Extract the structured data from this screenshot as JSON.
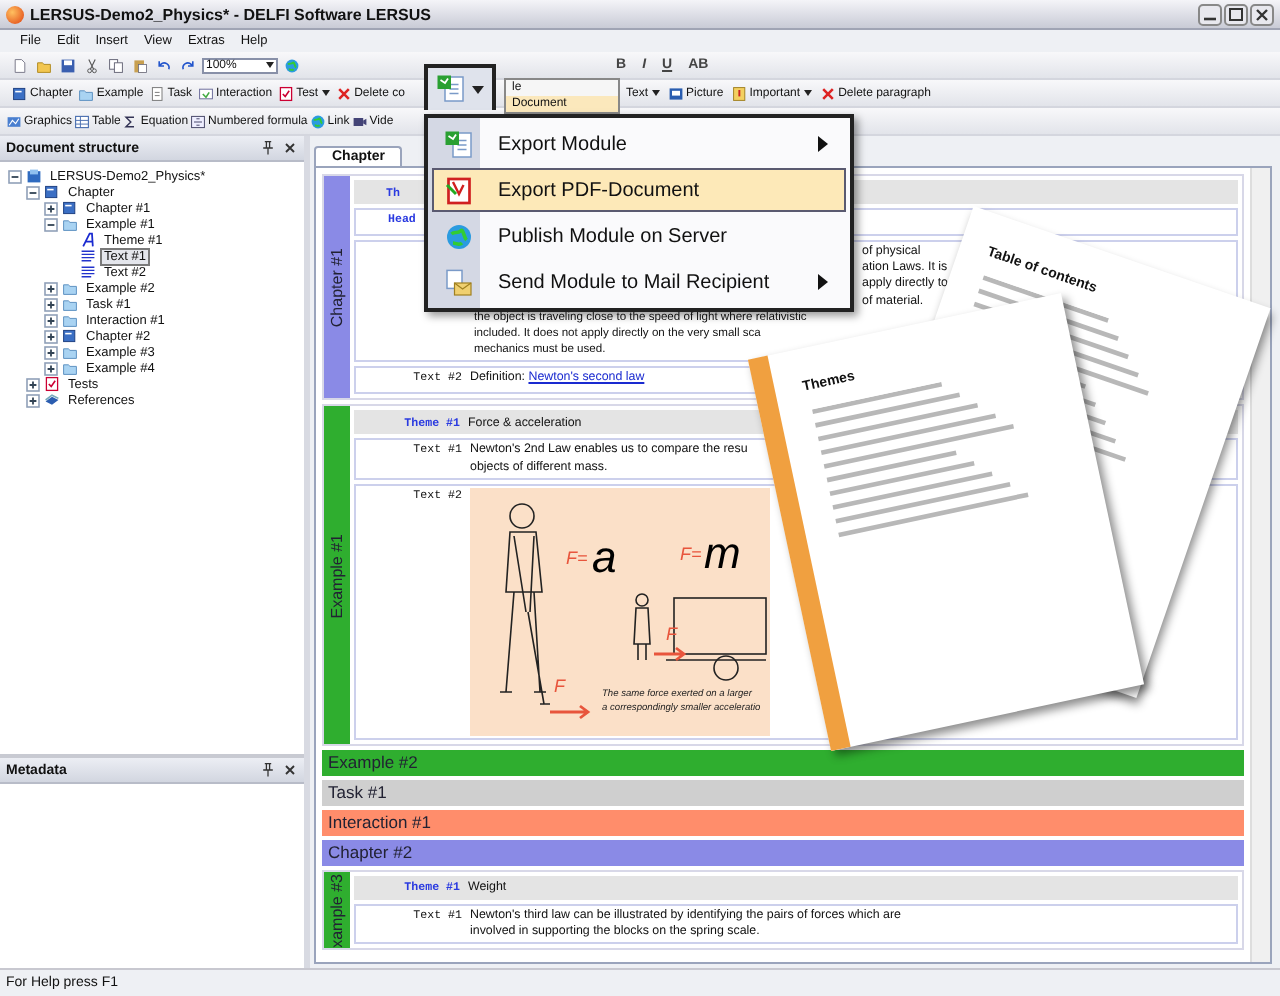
{
  "window": {
    "title": "LERSUS-Demo2_Physics* - DELFI Software LERSUS"
  },
  "menu": [
    "File",
    "Edit",
    "Insert",
    "View",
    "Extras",
    "Help"
  ],
  "toolbar_1": {
    "zoom": "100%",
    "format_buttons": [
      "B",
      "I",
      "U",
      "AB"
    ]
  },
  "toolbar_2": {
    "left": [
      {
        "label": "Chapter",
        "kind": "chapter",
        "dropdown": false
      },
      {
        "label": "Example",
        "kind": "example",
        "dropdown": false
      },
      {
        "label": "Task",
        "kind": "task",
        "dropdown": false
      },
      {
        "label": "Interaction",
        "kind": "interaction",
        "dropdown": false
      },
      {
        "label": "Test",
        "kind": "test",
        "dropdown": true
      },
      {
        "label": "Delete co",
        "kind": "delete",
        "dropdown": false
      }
    ],
    "right": [
      {
        "label": "Text",
        "kind": "none",
        "dropdown": true
      },
      {
        "label": "Picture",
        "kind": "picture",
        "dropdown": false
      },
      {
        "label": "Important",
        "kind": "important",
        "dropdown": true
      },
      {
        "label": "Delete paragraph",
        "kind": "delete",
        "dropdown": false
      }
    ]
  },
  "toolbar_3": [
    {
      "label": "Graphics",
      "kind": "graphics"
    },
    {
      "label": "Table",
      "kind": "table"
    },
    {
      "label": "Equation",
      "kind": "sigma"
    },
    {
      "label": "Numbered formula",
      "kind": "formula"
    },
    {
      "label": "Link",
      "kind": "link"
    },
    {
      "label": "Vide",
      "kind": "video"
    }
  ],
  "document_structure": {
    "title": "Document structure",
    "tree": [
      {
        "label": "LERSUS-Demo2_Physics*",
        "kind": "project",
        "expanded": true,
        "selected": false,
        "children": [
          {
            "label": "Chapter",
            "kind": "chapter",
            "expanded": true,
            "selected": false,
            "children": [
              {
                "label": "Chapter #1",
                "kind": "chapter",
                "expanded": false,
                "selected": false
              },
              {
                "label": "Example #1",
                "kind": "example",
                "expanded": true,
                "selected": false,
                "children": [
                  {
                    "label": "Theme #1",
                    "kind": "theme",
                    "selected": false
                  },
                  {
                    "label": "Text #1",
                    "kind": "text",
                    "selected": true
                  },
                  {
                    "label": "Text #2",
                    "kind": "text",
                    "selected": false
                  }
                ]
              },
              {
                "label": "Example #2",
                "kind": "example",
                "expanded": false,
                "selected": false
              },
              {
                "label": "Task #1",
                "kind": "example",
                "expanded": false,
                "selected": false
              },
              {
                "label": "Interaction #1",
                "kind": "example",
                "expanded": false,
                "selected": false
              },
              {
                "label": "Chapter #2",
                "kind": "chapter",
                "expanded": false,
                "selected": false
              },
              {
                "label": "Example #3",
                "kind": "example",
                "expanded": false,
                "selected": false
              },
              {
                "label": "Example #4",
                "kind": "example",
                "expanded": false,
                "selected": false
              }
            ]
          },
          {
            "label": "Tests",
            "kind": "test",
            "expanded": false,
            "selected": false
          },
          {
            "label": "References",
            "kind": "references",
            "expanded": false,
            "selected": false
          }
        ]
      }
    ]
  },
  "metadata": {
    "title": "Metadata"
  },
  "document_tabs": [
    {
      "label": "Chapter",
      "selected": true
    }
  ],
  "sections": [
    {
      "label": "Chapter #1",
      "color": "#8a8ae6",
      "expanded": true,
      "rows": [
        {
          "kind": "theme",
          "label": "Th"
        },
        {
          "kind": "heading",
          "label": "Head"
        },
        {
          "kind": "paragraph",
          "fragments": [
            "of physical",
            "ation Laws. It is",
            "apply directly to",
            "of material."
          ],
          "lines": [
            "the object is traveling close to the speed of light where relativistic",
            "included. It does not apply directly on the very small sca",
            "mechanics must be used."
          ]
        },
        {
          "kind": "text",
          "label": "Text #2",
          "text": "Definition: ",
          "link": "Newton's second law"
        }
      ]
    },
    {
      "label": "Example #1",
      "color": "#2fae2f",
      "expanded": true,
      "rows": [
        {
          "kind": "theme",
          "label": "Theme #1",
          "text": "Force & acceleration"
        },
        {
          "kind": "text",
          "label": "Text #1",
          "lines": [
            "Newton's 2nd Law enables us to compare the resu",
            "objects of different mass."
          ]
        },
        {
          "kind": "image",
          "label": "Text #2",
          "formula_1": [
            "F=",
            "a"
          ],
          "formula_2": [
            "F=",
            "m"
          ],
          "force_labels": [
            "F",
            "F"
          ],
          "caption": [
            "The same force exerted on a larger",
            "a correspondingly smaller acceleratio"
          ]
        }
      ]
    },
    {
      "label": "Example #2",
      "color": "#2fae2f",
      "expanded": false
    },
    {
      "label": "Task #1",
      "color": "#cfcfcf",
      "expanded": false
    },
    {
      "label": "Interaction #1",
      "color": "#ff8d6b",
      "expanded": false
    },
    {
      "label": "Chapter #2",
      "color": "#8a8ae6",
      "expanded": false
    },
    {
      "label": "xample #3",
      "color": "#2fae2f",
      "expanded": true,
      "rows": [
        {
          "kind": "theme",
          "label": "Theme #1",
          "text": "Weight"
        },
        {
          "kind": "text",
          "label": "Text #1",
          "lines": [
            "Newton's third law can be illustrated by identifying the pairs of forces which are",
            "involved in supporting the blocks on the spring scale."
          ]
        }
      ]
    }
  ],
  "underlying_menu": [
    {
      "label": "le",
      "selected": false
    },
    {
      "label": "Document",
      "selected": true
    }
  ],
  "export_popup": {
    "items": [
      {
        "label": "Export Module",
        "kind": "module",
        "submenu": true,
        "selected": false
      },
      {
        "label": "Export PDF-Document",
        "kind": "pdf",
        "submenu": false,
        "selected": true
      },
      {
        "label": "Publish Module on Server",
        "kind": "globe",
        "submenu": false,
        "selected": false
      },
      {
        "label": "Send Module to Mail Recipient",
        "kind": "mail",
        "submenu": true,
        "selected": false
      }
    ]
  },
  "page_previews": [
    {
      "title": "Table of contents",
      "kind": "contents"
    },
    {
      "title": "Themes",
      "kind": "themes"
    }
  ],
  "status_bar": "For Help press F1"
}
